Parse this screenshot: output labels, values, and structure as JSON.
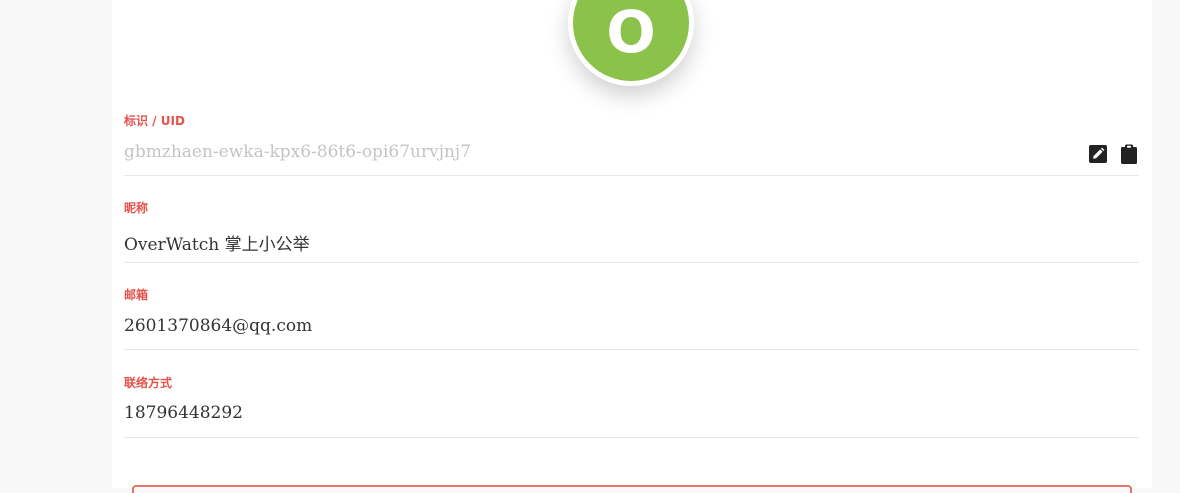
{
  "profile": {
    "avatar_letter": "O",
    "avatar_color": "#8bc34a",
    "label_color": "#e5534b"
  },
  "fields": {
    "uid": {
      "label": "标识 / UID",
      "value": "gbmzhaen-ewka-kpx6-86t6-opi67urvjnj7",
      "edit_icon": "edit-icon",
      "copy_icon": "clipboard-icon"
    },
    "nickname": {
      "label": "昵称",
      "value": "OverWatch 掌上小公举"
    },
    "email": {
      "label": "邮箱",
      "value": "2601370864@qq.com"
    },
    "contact": {
      "label": "联络方式",
      "value": "18796448292"
    }
  }
}
